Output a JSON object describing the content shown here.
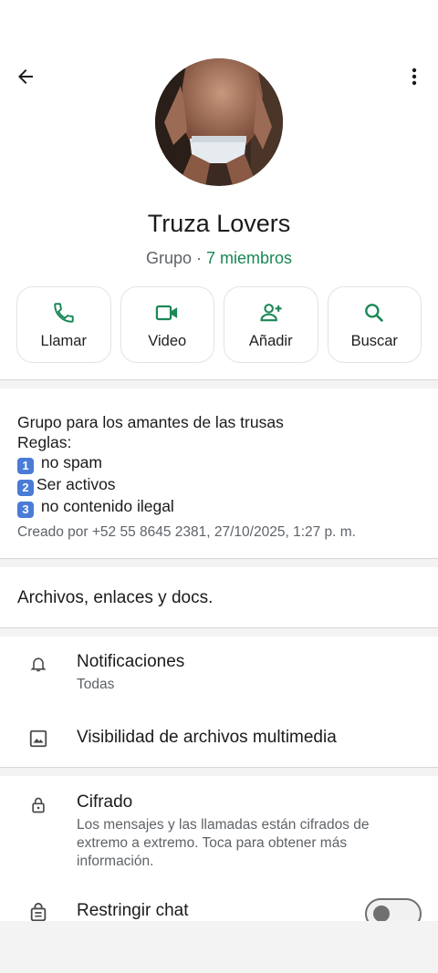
{
  "header": {
    "back_icon": "arrow-left-icon",
    "more_icon": "more-vert-icon"
  },
  "group": {
    "name": "Truza Lovers",
    "type_label": "Grupo",
    "separator": " · ",
    "members": "7 miembros"
  },
  "actions": [
    {
      "label": "Llamar",
      "icon": "phone-icon"
    },
    {
      "label": "Video",
      "icon": "video-icon"
    },
    {
      "label": "Añadir",
      "icon": "add-person-icon"
    },
    {
      "label": "Buscar",
      "icon": "search-icon"
    }
  ],
  "description": {
    "line1": "Grupo para los amantes de las trusas",
    "line2": "Reglas:",
    "rule1_num": "1",
    "rule1": " no spam",
    "rule2_num": "2",
    "rule2": "Ser activos",
    "rule3_num": "3",
    "rule3": " no contenido ilegal",
    "created": "Creado por +52 55 8645 2381, 27/10/2025, 1:27 p. m."
  },
  "files_row": "Archivos, enlaces y docs.",
  "settings": {
    "notifications_title": "Notificaciones",
    "notifications_value": "Todas",
    "media_visibility": "Visibilidad de archivos multimedia",
    "encryption_title": "Cifrado",
    "encryption_desc": "Los mensajes y las llamadas están cifrados de extremo a extremo. Toca para obtener más información.",
    "restrict_title": "Restringir chat",
    "restrict_enabled": false
  },
  "colors": {
    "accent": "#1b8755",
    "text": "#1b1b1b",
    "secondary": "#5f6368",
    "keycap": "#4a7bd6"
  }
}
